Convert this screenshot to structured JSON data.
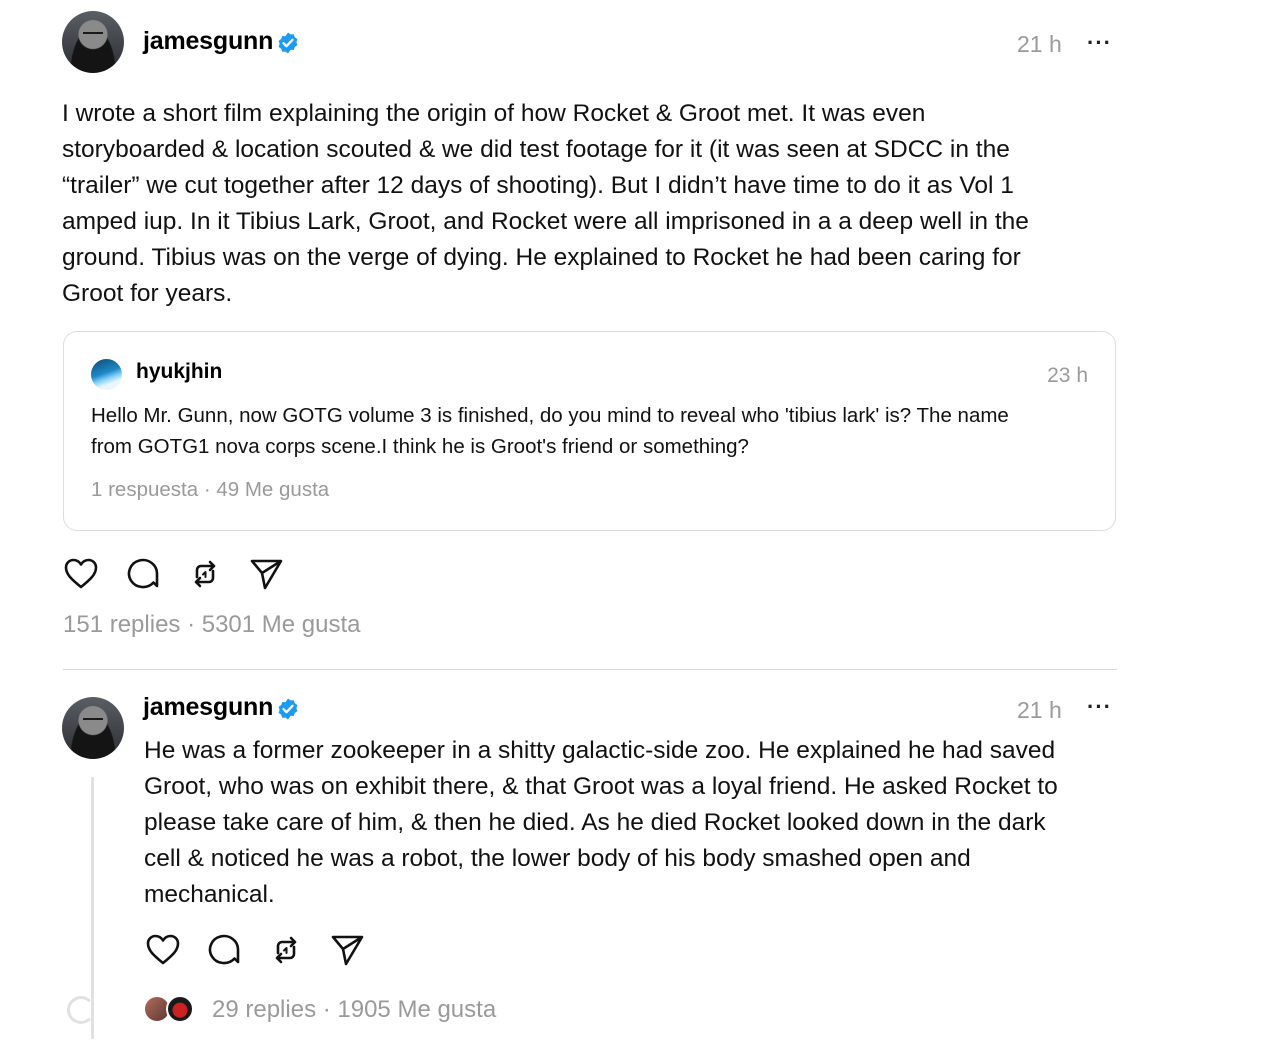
{
  "post": {
    "username": "jamesgunn",
    "time": "21 h",
    "more": "···",
    "text": "I wrote a short film explaining the origin of how Rocket & Groot met. It was even\nstoryboarded & location scouted & we did test footage for it (it was seen at SDCC in the\n“trailer” we cut together after 12 days of shooting). But I didn’t have time to do it as Vol 1\namped iup. In it Tibius Lark, Groot, and Rocket were all imprisoned in a a deep well in the\nground. Tibius was on the verge of dying. He explained to Rocket he had been caring for\nGroot for years.",
    "quote": {
      "username": "hyukjhin",
      "time": "23 h",
      "text": "Hello Mr. Gunn, now GOTG volume 3 is finished, do you mind to reveal who 'tibius lark' is? The name\nfrom GOTG1 nova corps scene.I think he is Groot's friend or something?",
      "stats": "1 respuesta · 49 Me gusta"
    },
    "stats": "151 replies · 5301 Me gusta"
  },
  "reply": {
    "username": "jamesgunn",
    "time": "21 h",
    "more": "···",
    "text": "He was a former zookeeper in a shitty galactic-side zoo. He explained he had saved\nGroot, who was on exhibit there, & that Groot was a loyal friend. He asked Rocket to\nplease take care of him, & then he died. As he died Rocket looked down in the dark\ncell & noticed he was a robot, the lower body of his body smashed open and\nmechanical.",
    "stats": "29 replies · 1905 Me gusta"
  },
  "icons": {
    "verified": "verified-badge-icon",
    "like": "heart-icon",
    "reply": "comment-icon",
    "repost": "repost-icon",
    "share": "send-icon"
  },
  "colors": {
    "verified": "#1d9bf0",
    "muted": "#9a9a9a",
    "border": "#dcdcdc"
  }
}
